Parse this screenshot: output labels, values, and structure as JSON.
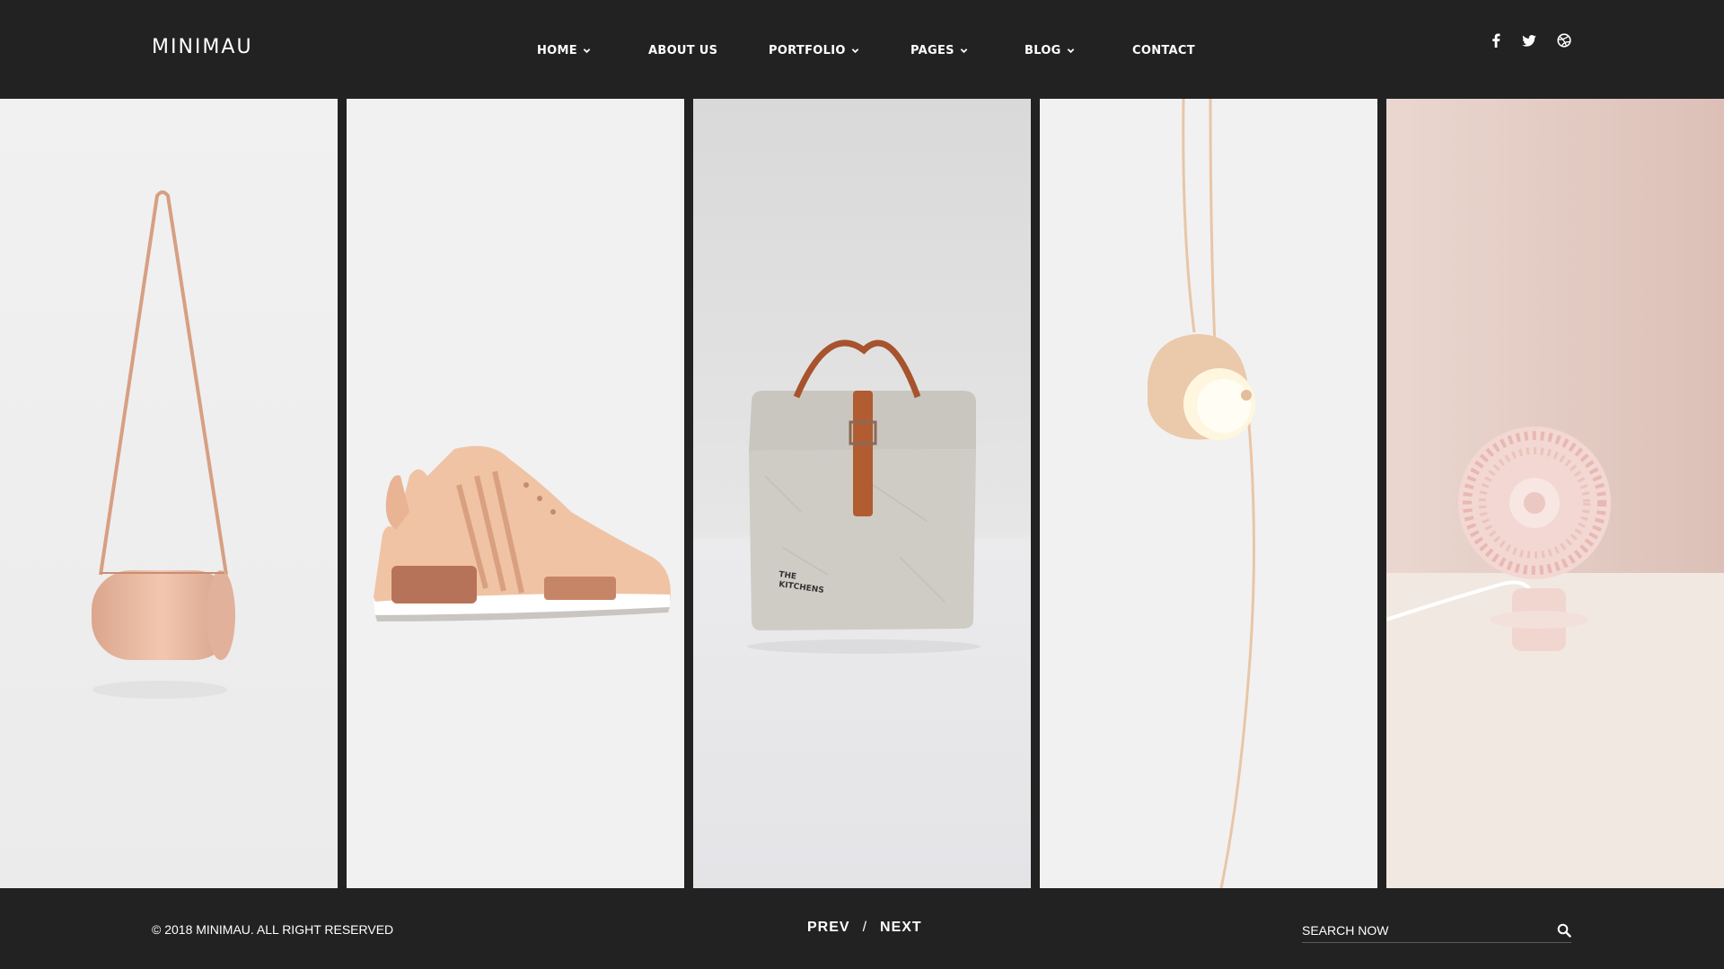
{
  "brand": {
    "logo": "MINIMAU"
  },
  "nav": {
    "items": [
      {
        "label": "HOME",
        "has_dropdown": true
      },
      {
        "label": "ABOUT US",
        "has_dropdown": false
      },
      {
        "label": "PORTFOLIO",
        "has_dropdown": true
      },
      {
        "label": "PAGES",
        "has_dropdown": true
      },
      {
        "label": "BLOG",
        "has_dropdown": true
      },
      {
        "label": "CONTACT",
        "has_dropdown": false
      }
    ]
  },
  "social": {
    "icons": [
      "facebook-icon",
      "twitter-icon",
      "dribbble-icon"
    ]
  },
  "gallery": {
    "items": [
      {
        "name": "crossbody-bag",
        "bg": "#efefef"
      },
      {
        "name": "leather-sneaker",
        "bg": "#f1f1f1"
      },
      {
        "name": "paper-lunch-bag",
        "bg": "#e4e4e6",
        "print": "THE\nKITCHENS"
      },
      {
        "name": "pendant-lamp",
        "bg": "#f0f0f0"
      },
      {
        "name": "desk-fan",
        "bg": "#e6d3cd"
      }
    ]
  },
  "footer": {
    "copyright": "© 2018 MINIMAU. ALL RIGHT RESERVED",
    "prev_label": "PREV",
    "separator": "/",
    "next_label": "NEXT"
  },
  "search": {
    "placeholder": "SEARCH NOW",
    "value": ""
  },
  "colors": {
    "bar_bg": "#222222",
    "text": "#ffffff",
    "accent_leather": "#e7b99c"
  }
}
